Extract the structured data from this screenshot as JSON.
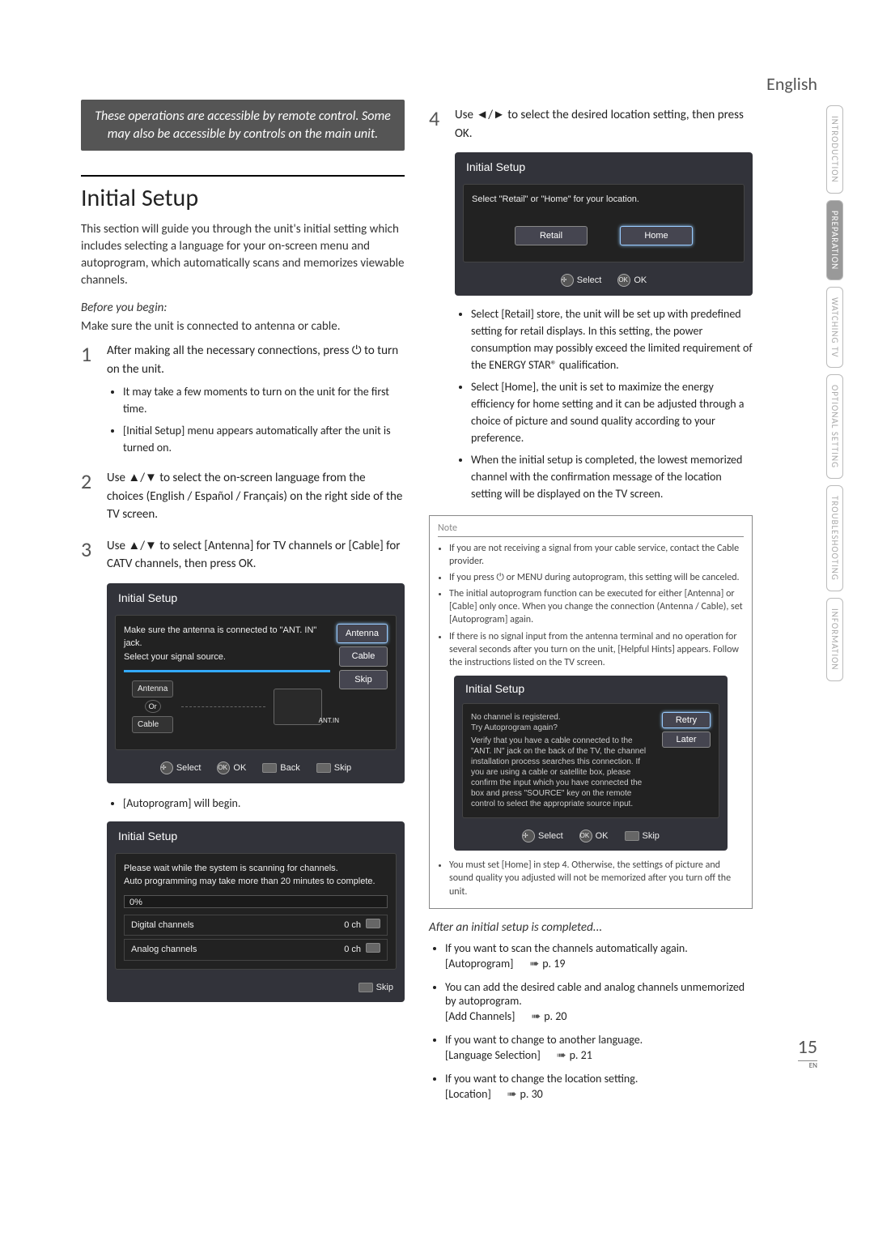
{
  "language": "English",
  "side_tabs": [
    "INTRODUCTION",
    "PREPARATION",
    "WATCHING TV",
    "OPTIONAL SETTING",
    "TROUBLESHOOTING",
    "INFORMATION"
  ],
  "callout": "These operations are accessible by remote control. Some may also be accessible by controls on the main unit.",
  "section_title": "Initial Setup",
  "intro": "This section will guide you through the unit's initial setting which includes selecting a language for your on-screen menu and autoprogram, which automatically scans and memorizes viewable channels.",
  "before_begin_h": "Before you begin:",
  "before_begin_t": "Make sure the unit is connected to antenna or cable.",
  "steps": {
    "s1": "After making all the necessary connections, press ⏻ to turn on the unit.",
    "s1a": "It may take a few moments to turn on the unit for the first time.",
    "s1b": "[Initial Setup] menu appears automatically after the unit is turned on.",
    "s2": "Use ▲/▼ to select the on-screen language from the choices (English / Español / Français) on the right side of the TV screen.",
    "s3": "Use ▲/▼ to select [Antenna] for TV channels or [Cable] for CATV channels, then press OK.",
    "s4": "Use ◄/► to select the desired location setting, then press OK."
  },
  "panel1": {
    "title": "Initial Setup",
    "line1": "Make sure the antenna is connected to \"ANT. IN\" jack.",
    "line2": "Select your signal source.",
    "btns": [
      "Antenna",
      "Cable",
      "Skip"
    ],
    "antenna_label": "Antenna",
    "cable_label": "Cable",
    "or": "Or",
    "antin": "ANT.IN",
    "bottom": {
      "select": "Select",
      "ok": "OK",
      "back": "Back",
      "skip": "Skip"
    }
  },
  "autoprog_begin": "[Autoprogram] will begin.",
  "panel2": {
    "title": "Initial Setup",
    "line1": "Please wait while the system is scanning for channels.",
    "line2": "Auto programming may take more than 20 minutes to complete.",
    "pct": "0%",
    "digital": "Digital channels",
    "analog": "Analog channels",
    "ch0": "0 ch",
    "skip": "Skip"
  },
  "panel3": {
    "title": "Initial Setup",
    "prompt": "Select \"Retail\" or \"Home\" for your location.",
    "retail": "Retail",
    "home": "Home",
    "select": "Select",
    "ok": "OK"
  },
  "step4_bullets": {
    "b1": "Select [Retail] store, the unit will be set up with predefined setting for retail displays. In this setting, the power consumption may possibly exceed the limited requirement of the ENERGY STAR® qualification.",
    "b2": "Select [Home], the unit is set to maximize the energy efficiency for home setting and it can be adjusted through a choice of picture and sound quality according to your preference.",
    "b3": "When the initial setup is completed, the lowest memorized channel with the confirmation message of the location setting will be displayed on the TV screen."
  },
  "note": {
    "title": "Note",
    "n1": "If you are not receiving a signal from your cable service, contact the Cable provider.",
    "n2": "If you press ⏻ or MENU during autoprogram, this setting will be canceled.",
    "n3": "The initial autoprogram function can be executed for either [Antenna] or [Cable] only once. When you change the connection (Antenna / Cable), set [Autoprogram] again.",
    "n4": "If there is no signal input from the antenna terminal and no operation for several seconds after you turn on the unit, [Helpful Hints] appears. Follow the instructions listed on the TV screen.",
    "panel": {
      "title": "Initial Setup",
      "l1": "No channel is registered.",
      "l2": "Try Autoprogram again?",
      "l3": "Verify that you have a cable connected to the \"ANT. IN\" jack on the back of the TV, the channel installation process searches this connection. If you are using a cable or satellite box, please confirm the input which you have connected the box and press \"SOURCE\" key on the remote control to select the appropriate source input.",
      "retry": "Retry",
      "later": "Later",
      "select": "Select",
      "ok": "OK",
      "skip": "Skip"
    },
    "n5": "You must set [Home] in step 4. Otherwise, the settings of picture and sound quality you adjusted will not be memorized after you turn off the unit."
  },
  "after_h": "After an initial setup is completed...",
  "after": {
    "a1": "If you want to scan the channels automatically again.",
    "a1ref": "[Autoprogram]",
    "a1p": "p. 19",
    "a2": "You can add the desired cable and analog channels unmemorized by autoprogram.",
    "a2ref": "[Add Channels]",
    "a2p": "p. 20",
    "a3": "If you want to change to another language.",
    "a3ref": "[Language Selection]",
    "a3p": "p. 21",
    "a4": "If you want to change the location setting.",
    "a4ref": "[Location]",
    "a4p": "p. 30"
  },
  "page_number": "15",
  "page_en": "EN"
}
